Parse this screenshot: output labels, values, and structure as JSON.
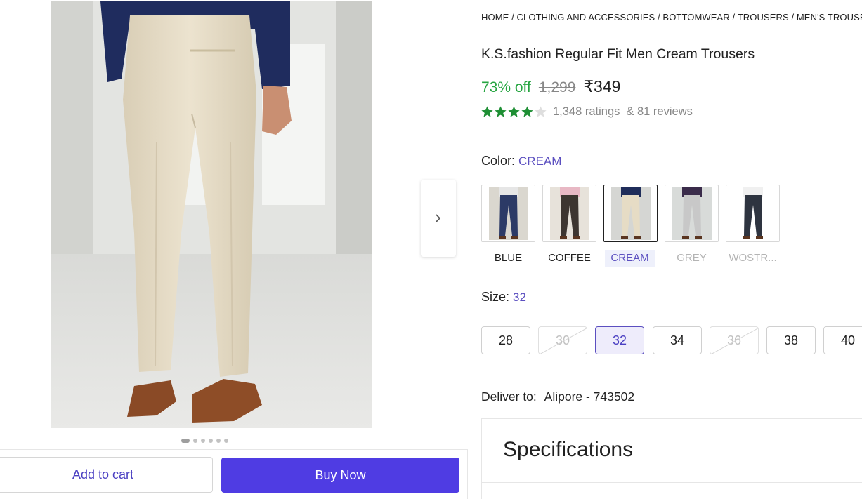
{
  "breadcrumb": [
    "HOME",
    "CLOTHING AND ACCESSORIES",
    "BOTTOMWEAR",
    "TROUSERS",
    "MEN'S TROUSERS"
  ],
  "breadcrumb_sep": " / ",
  "product": {
    "title": "K.S.fashion Regular Fit Men Cream Trousers",
    "discount": "73% off",
    "mrp": "1,299",
    "price": "₹349",
    "rating_stars": 4,
    "ratings_text": "1,348 ratings",
    "reviews_text": "& 81 reviews"
  },
  "color": {
    "label": "Color:",
    "selected": "CREAM",
    "options": [
      {
        "name": "BLUE",
        "pant": "#2c3a66",
        "shirt": "#e6e6e6",
        "bg": "#dad7cf",
        "available": true
      },
      {
        "name": "COFFEE",
        "pant": "#3d3530",
        "shirt": "#e8b8c4",
        "bg": "#e7e2da",
        "available": true
      },
      {
        "name": "CREAM",
        "pant": "#e6dcc5",
        "shirt": "#1f2d5a",
        "bg": "#d5d6d3",
        "available": true
      },
      {
        "name": "GREY",
        "pant": "#c8c8c8",
        "shirt": "#3a2b4a",
        "bg": "#d8dbd9",
        "available": false
      },
      {
        "name": "WOSTR...",
        "pant": "#2e3440",
        "shirt": "#f0f0f0",
        "bg": "#ffffff",
        "available": false
      }
    ]
  },
  "size": {
    "label": "Size:",
    "selected": "32",
    "options": [
      {
        "value": "28",
        "available": true
      },
      {
        "value": "30",
        "available": false
      },
      {
        "value": "32",
        "available": true
      },
      {
        "value": "34",
        "available": true
      },
      {
        "value": "36",
        "available": false
      },
      {
        "value": "38",
        "available": true
      },
      {
        "value": "40",
        "available": true
      }
    ]
  },
  "delivery": {
    "label": "Deliver to:",
    "location": "Alipore - 743502"
  },
  "specifications": {
    "title": "Specifications"
  },
  "actions": {
    "add_to_cart": "Add to cart",
    "buy_now": "Buy Now"
  },
  "gallery": {
    "image_count": 6,
    "active_index": 0
  },
  "colors": {
    "accent": "#4f3ce3",
    "discount": "#26a541",
    "star": "#1e8f34",
    "link": "#5b4fc0"
  }
}
